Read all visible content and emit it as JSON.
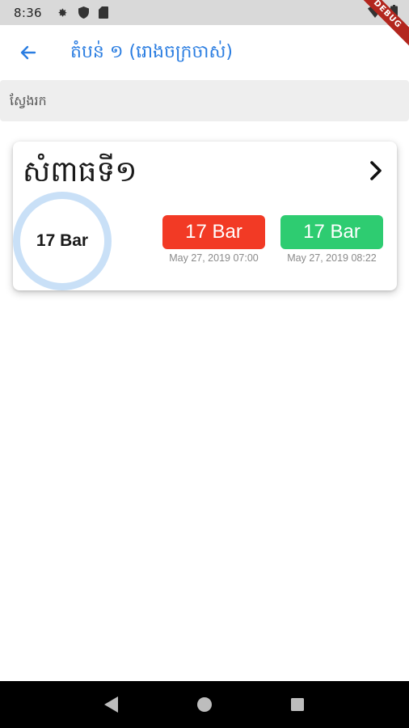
{
  "status_bar": {
    "time": "8:36",
    "icons": [
      "gear-icon",
      "shield-icon",
      "sim-card-icon",
      "wifi-icon",
      "battery-icon"
    ]
  },
  "debug_banner": "DEBUG",
  "app_bar": {
    "back_icon": "arrow-left-icon",
    "title": "តំបន់ ១ (រោងចក្រចាស់)",
    "accent_color": "#2a7de1"
  },
  "search": {
    "placeholder": "ស្វែងរក"
  },
  "card": {
    "title": "សំពាធទី១",
    "chevron_icon": "chevron-right-icon",
    "gauge": {
      "label": "17 Bar",
      "ring_color": "#c9e0f7"
    },
    "readings": [
      {
        "value": "17 Bar",
        "time": "May 27, 2019 07:00",
        "color": "#f23a25"
      },
      {
        "value": "17 Bar",
        "time": "May 27, 2019 08:22",
        "color": "#2ecc71"
      }
    ]
  },
  "nav_bar": {
    "buttons": [
      "back-triangle-icon",
      "home-circle-icon",
      "recents-square-icon"
    ]
  }
}
